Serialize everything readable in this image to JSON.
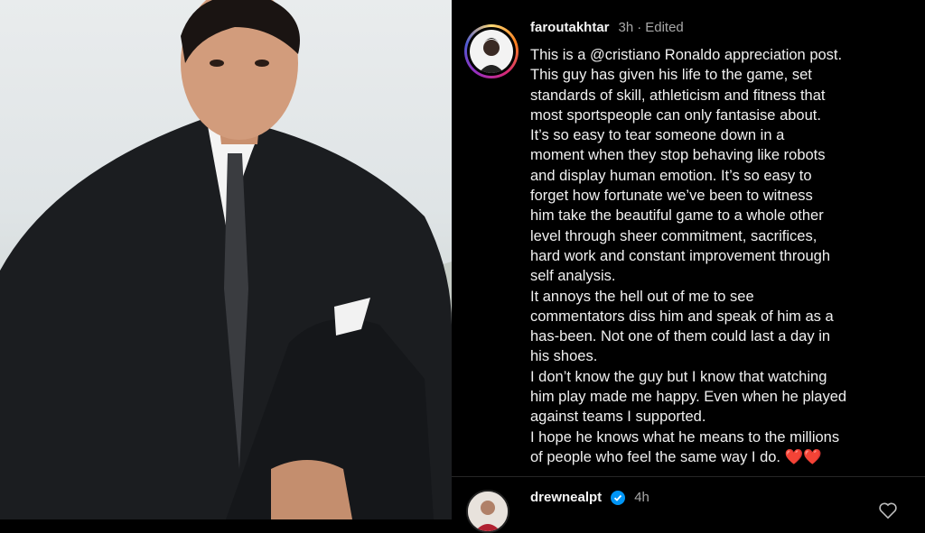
{
  "post": {
    "username": "faroutakhtar",
    "time": "3h",
    "edited_label": "Edited",
    "caption": "This is a @cristiano Ronaldo appreciation post.\nThis guy has given his life to the game, set\nstandards of skill, athleticism and fitness that\nmost sportspeople can only fantasise about.\nIt’s so easy to tear someone down in a\nmoment when they stop behaving like robots\nand display human emotion. It’s so easy to\nforget how fortunate we’ve been to witness\nhim take the beautiful game to a whole other\nlevel through sheer commitment, sacrifices,\nhard work and constant improvement through\nself analysis.\nIt annoys the hell out of me to see\ncommentators diss him and speak of him as a\nhas-been. Not one of them could last a day in\nhis shoes.\nI don’t know the guy but I know that watching\nhim play made me happy. Even when he played\nagainst teams I supported.\nI hope he knows what he means to the millions\nof people who feel the same way I do.",
    "caption_emoji": "❤️❤️"
  },
  "comment": {
    "username": "drewnealpt",
    "time": "4h"
  },
  "colors": {
    "background": "#000000",
    "verified": "#0095f6",
    "heart": "#e0245e"
  },
  "icons": [
    "verified-badge-icon",
    "heart-outline-icon"
  ]
}
